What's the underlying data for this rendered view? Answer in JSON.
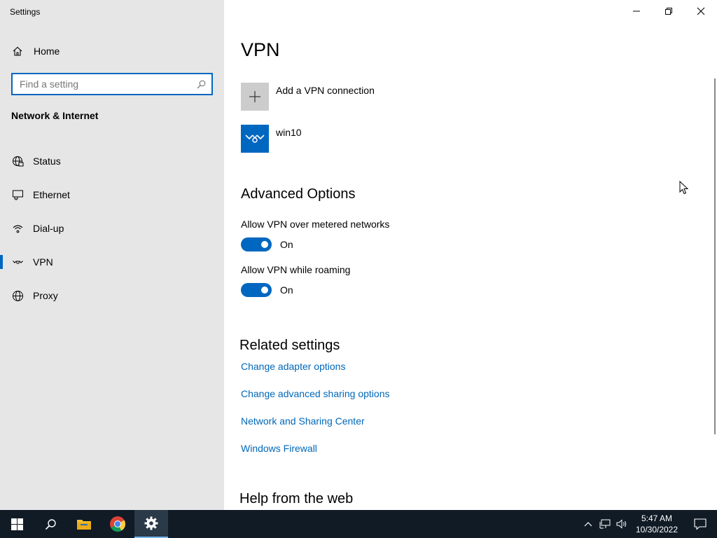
{
  "app": {
    "title": "Settings"
  },
  "sidebar": {
    "home_label": "Home",
    "search_placeholder": "Find a setting",
    "section_title": "Network & Internet",
    "items": [
      {
        "label": "Status",
        "icon": "globe-status-icon"
      },
      {
        "label": "Ethernet",
        "icon": "ethernet-icon"
      },
      {
        "label": "Dial-up",
        "icon": "dialup-icon"
      },
      {
        "label": "VPN",
        "icon": "vpn-icon",
        "active": true
      },
      {
        "label": "Proxy",
        "icon": "globe-icon"
      }
    ]
  },
  "main": {
    "title": "VPN",
    "add_vpn_label": "Add a VPN connection",
    "connections": [
      {
        "name": "win10"
      }
    ],
    "advanced": {
      "heading": "Advanced Options",
      "metered_label": "Allow VPN over metered networks",
      "metered_state": "On",
      "roaming_label": "Allow VPN while roaming",
      "roaming_state": "On"
    },
    "related": {
      "heading": "Related settings",
      "links": [
        "Change adapter options",
        "Change advanced sharing options",
        "Network and Sharing Center",
        "Windows Firewall"
      ]
    },
    "help_heading": "Help from the web"
  },
  "taskbar": {
    "time": "5:47 AM",
    "date": "10/30/2022"
  },
  "colors": {
    "accent": "#0067c0",
    "link": "#0067b8",
    "sidebar_bg": "#e6e6e6",
    "taskbar_bg": "#101b26"
  }
}
